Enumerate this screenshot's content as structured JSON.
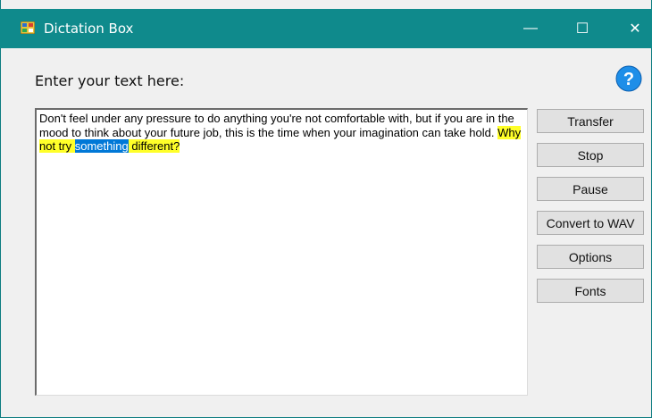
{
  "window": {
    "title": "Dictation Box",
    "controls": {
      "minimize": "—",
      "maximize": "☐",
      "close": "✕"
    }
  },
  "form": {
    "prompt": "Enter your text here:",
    "help_icon": "help-question-icon"
  },
  "textbox": {
    "text_before": "Don't feel under any pressure to do anything you're not comfortable with, but if you are in the mood to think about your future job, this is the time when your imagination can take hold. ",
    "highlight_before": "Why not try ",
    "selected_word": "something",
    "highlight_after": " different?"
  },
  "buttons": {
    "transfer": "Transfer",
    "stop": "Stop",
    "pause": "Pause",
    "convert": "Convert to WAV",
    "options": "Options",
    "fonts": "Fonts"
  },
  "colors": {
    "titlebar": "#0f8a8c",
    "highlight": "#ffff29",
    "selection": "#0078d7",
    "help_icon": "#1e8ee8"
  }
}
